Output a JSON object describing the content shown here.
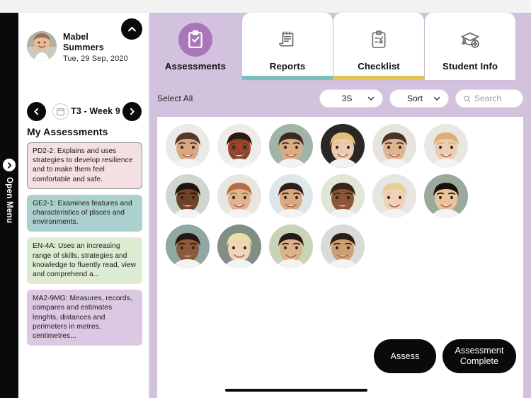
{
  "rail": {
    "label": "Open Menu",
    "icon": "chevron-right-icon"
  },
  "sidebar": {
    "collapse_icon": "chevron-up-icon",
    "teacher": {
      "first_name": "Mabel",
      "last_name": "Summers",
      "date": "Tue, 29 Sep, 2020",
      "avatar_icon": "teacher-avatar"
    },
    "weeknav": {
      "prev_icon": "chevron-left-icon",
      "calendar_icon": "calendar-icon",
      "label": "T3 - Week 9",
      "next_icon": "chevron-right-icon"
    },
    "section_title": "My Assessments",
    "assessments": [
      {
        "text": "PD2-2: Explains and uses strategies to develop resilience and to make them feel comfortable and safe.",
        "color": "#f4dfe2",
        "selected": true
      },
      {
        "text": "GE2-1: Examines features and characteristics of places and environments.",
        "color": "#abd0cd",
        "selected": false
      },
      {
        "text": "EN-4A: Uses an increasing range of skills, strategies and knowledge to fluently read, view and comprehend a...",
        "color": "#dcebd2",
        "selected": false
      },
      {
        "text": "MA2-9MG: Measures, records, compares and estimates lenghts, distances and perimeters in metres, centimetres...",
        "color": "#ddc8e3",
        "selected": false
      }
    ]
  },
  "main": {
    "accent_purple": "#d3c2dd",
    "active_icon_purple": "#a977b8",
    "tabs": [
      {
        "label": "Assessments",
        "icon": "clipboard-check-icon",
        "active": true,
        "underline": ""
      },
      {
        "label": "Reports",
        "icon": "report-notepad-icon",
        "active": false,
        "underline": "#7cbfc0"
      },
      {
        "label": "Checklist",
        "icon": "clipboard-list-icon",
        "active": false,
        "underline": "#e0c44f"
      },
      {
        "label": "Student Info",
        "icon": "graduation-cap-add-icon",
        "active": false,
        "underline": ""
      }
    ],
    "toolbar": {
      "select_all": "Select All",
      "class_value": "3S",
      "class_chevron_icon": "chevron-down-icon",
      "sort_value": "Sort",
      "sort_chevron_icon": "chevron-down-icon",
      "search_icon": "search-icon",
      "search_placeholder": "Search"
    },
    "students": [
      {
        "name": "student-1",
        "skin": "#d9a882",
        "hair": "#54392a",
        "bg": "#eceae6"
      },
      {
        "name": "student-2",
        "skin": "#7b4a2e",
        "hair": "#2b1a12",
        "bg": "#efece8",
        "glasses": true
      },
      {
        "name": "student-3",
        "skin": "#d9ac86",
        "hair": "#3b2a1d",
        "bg": "#9fb5a8"
      },
      {
        "name": "student-4",
        "skin": "#eccbb0",
        "hair": "#e2c07a",
        "bg": "#2b2725"
      },
      {
        "name": "student-5",
        "skin": "#e0b392",
        "hair": "#4a3324",
        "bg": "#e7e4df"
      },
      {
        "name": "student-6",
        "skin": "#ecccb2",
        "hair": "#d9b071",
        "bg": "#eae7e3"
      },
      {
        "name": "student-7",
        "skin": "#6e4229",
        "hair": "#1f1410",
        "bg": "#cdd6cf"
      },
      {
        "name": "student-8",
        "skin": "#e0b392",
        "hair": "#b4703f",
        "bg": "#e9e6e1"
      },
      {
        "name": "student-9",
        "skin": "#d9a87f",
        "hair": "#2d2018",
        "bg": "#dde7ea"
      },
      {
        "name": "student-10",
        "skin": "#8a5636",
        "hair": "#3a2318",
        "bg": "#e2e6d8"
      },
      {
        "name": "student-11",
        "skin": "#f0d2b8",
        "hair": "#e6cf93",
        "bg": "#e8e6e2"
      },
      {
        "name": "student-12",
        "skin": "#e8c39c",
        "hair": "#17110d",
        "bg": "#9aa99c"
      },
      {
        "name": "student-13",
        "skin": "#8b5a39",
        "hair": "#251611",
        "bg": "#8fa8a4"
      },
      {
        "name": "student-14",
        "skin": "#f0d4ba",
        "hair": "#e9dfa8",
        "bg": "#7f8f84"
      },
      {
        "name": "student-15",
        "skin": "#ddb189",
        "hair": "#241a13",
        "bg": "#c9d3b8"
      },
      {
        "name": "student-16",
        "skin": "#cf9f74",
        "hair": "#2a1d14",
        "bg": "#dcdad6"
      }
    ],
    "actions": {
      "assess": "Assess",
      "assessment_complete": "Assessment Complete"
    }
  }
}
